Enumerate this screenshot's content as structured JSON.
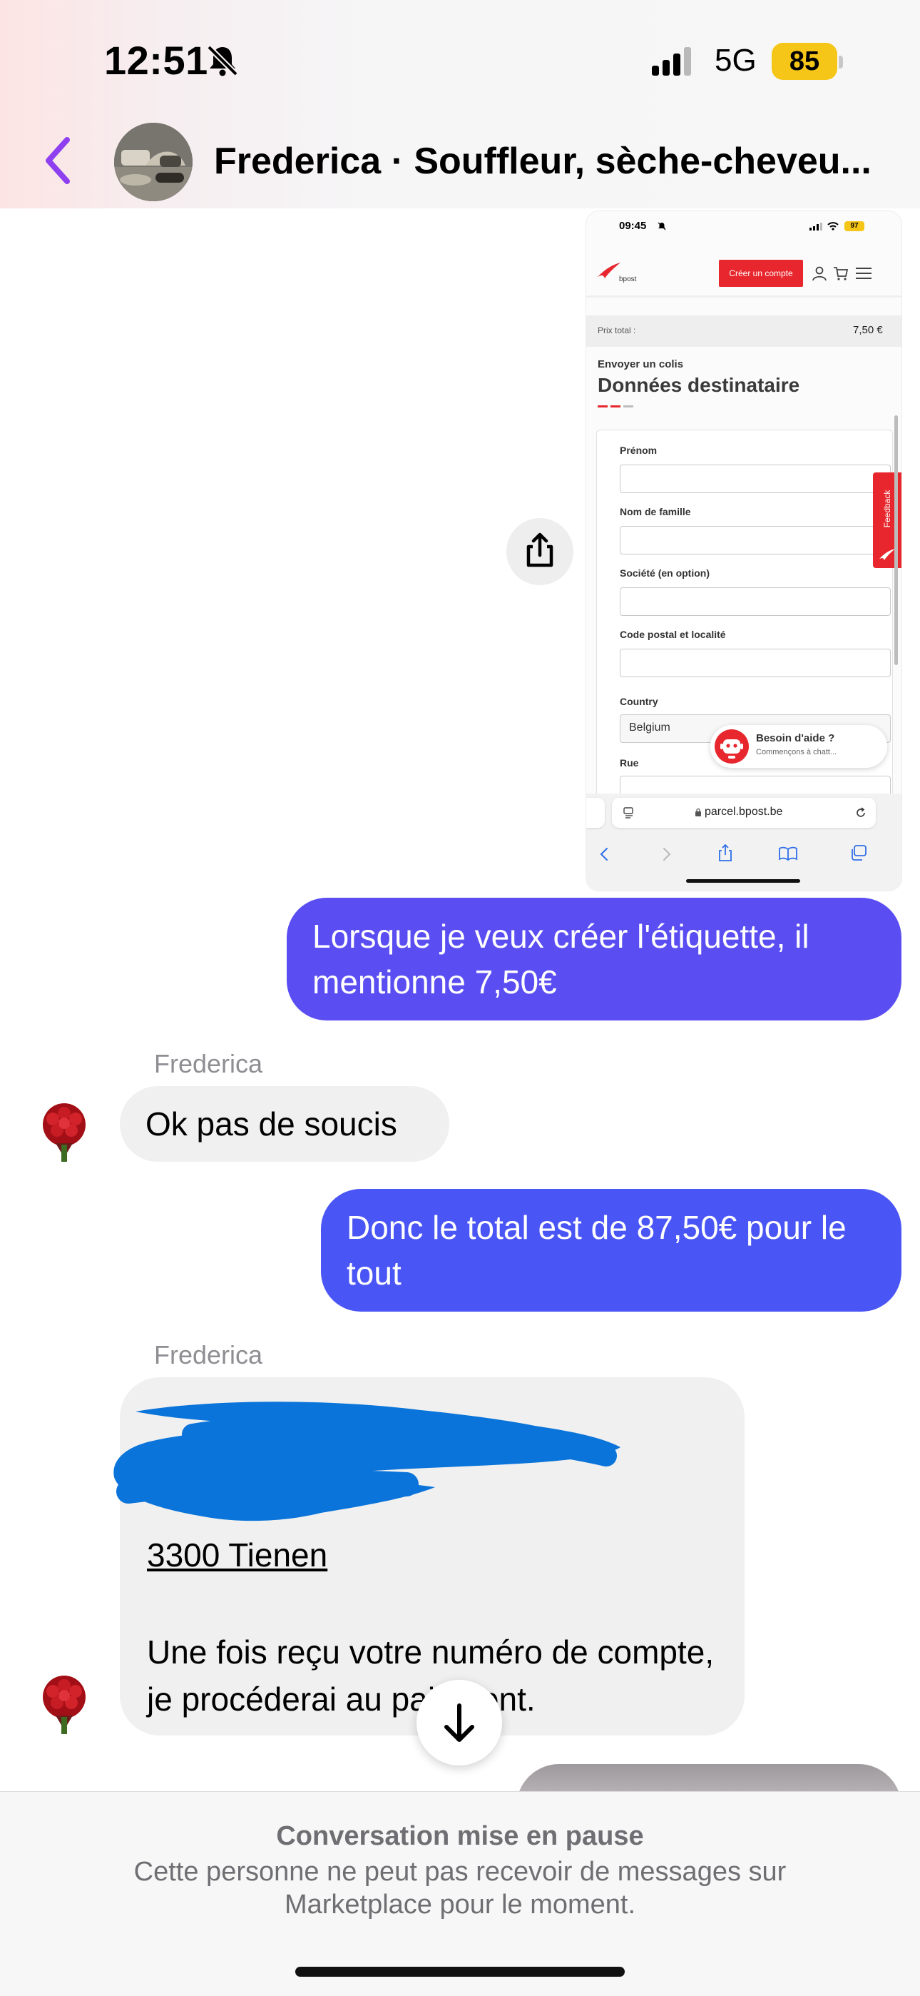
{
  "status_bar": {
    "time": "12:51",
    "network": "5G",
    "battery": "85"
  },
  "header": {
    "title": "Frederica · Souffleur, sèche-cheveu..."
  },
  "attachment": {
    "time": "09:45",
    "battery": "97",
    "logo_text": "bpost",
    "create_account": "Créer un compte",
    "price_label": "Prix total :",
    "price_value": "7,50 €",
    "step_label": "Envoyer un colis",
    "heading": "Données destinataire",
    "fields": {
      "first_name": "Prénom",
      "last_name": "Nom de famille",
      "company": "Société (en option)",
      "postcode": "Code postal et localité",
      "country": "Country",
      "country_value": "Belgium",
      "street": "Rue"
    },
    "feedback": "Feedback",
    "help_title": "Besoin d'aide ?",
    "help_sub": "Commençons à chatt...",
    "url": "parcel.bpost.be"
  },
  "messages": {
    "out_1": "Lorsque je veux créer l'étiquette, il mentionne 7,50€",
    "sender_1": "Frederica",
    "in_1": "Ok pas de soucis",
    "out_2": "Donc le total est de 87,50€ pour le tout",
    "sender_2": "Frederica",
    "in_2_address": "3300 Tienen",
    "in_2_text": "Une fois reçu votre numéro de compte, je procéderai au paiement."
  },
  "footer": {
    "title": "Conversation mise en pause",
    "description": "Cette personne ne peut pas recevoir de messages sur Marketplace pour le moment."
  },
  "colors": {
    "accent": "#8e3ff0",
    "bubble_out_1": "#5a4df2",
    "bubble_out_2": "#4a55f5",
    "bpost_red": "#e7272d",
    "battery": "#f5c518"
  }
}
